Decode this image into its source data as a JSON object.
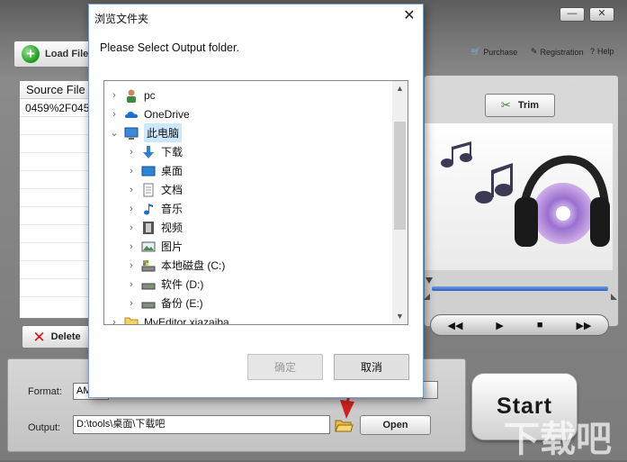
{
  "app": {
    "load_file_label": "Load File",
    "links": {
      "purchase": "Purchase",
      "registration": "Registration",
      "help": "Help"
    },
    "source_file_header": "Source File",
    "source_file_row": "0459%2F045",
    "delete_label": "Delete",
    "format_label": "Format:",
    "format_value": "AM",
    "output_label": "Output:",
    "output_value": "D:\\tools\\桌面\\下载吧",
    "open_label": "Open",
    "trim_label": "Trim",
    "start_label": "Start",
    "watermark": "下载吧"
  },
  "dialog": {
    "title": "浏览文件夹",
    "prompt": "Please Select Output folder.",
    "ok_label": "确定",
    "cancel_label": "取消",
    "tree": [
      {
        "label": "pc",
        "icon": "user-icon"
      },
      {
        "label": "OneDrive",
        "icon": "cloud-icon"
      },
      {
        "label": "此电脑",
        "icon": "computer-icon",
        "selected": true
      },
      {
        "label": "下载",
        "icon": "download-icon"
      },
      {
        "label": "桌面",
        "icon": "desktop-icon"
      },
      {
        "label": "文档",
        "icon": "document-icon"
      },
      {
        "label": "音乐",
        "icon": "music-icon"
      },
      {
        "label": "视频",
        "icon": "video-icon"
      },
      {
        "label": "图片",
        "icon": "picture-icon"
      },
      {
        "label": "本地磁盘 (C:)",
        "icon": "system-drive-icon"
      },
      {
        "label": "软件 (D:)",
        "icon": "drive-icon"
      },
      {
        "label": "备份 (E:)",
        "icon": "drive-icon"
      },
      {
        "label": "MyEditor xiazaiba",
        "icon": "folder-icon"
      }
    ]
  },
  "colors": {
    "accent": "#2e5fbf",
    "selection": "#cce8ff",
    "arrow": "#d42020"
  }
}
